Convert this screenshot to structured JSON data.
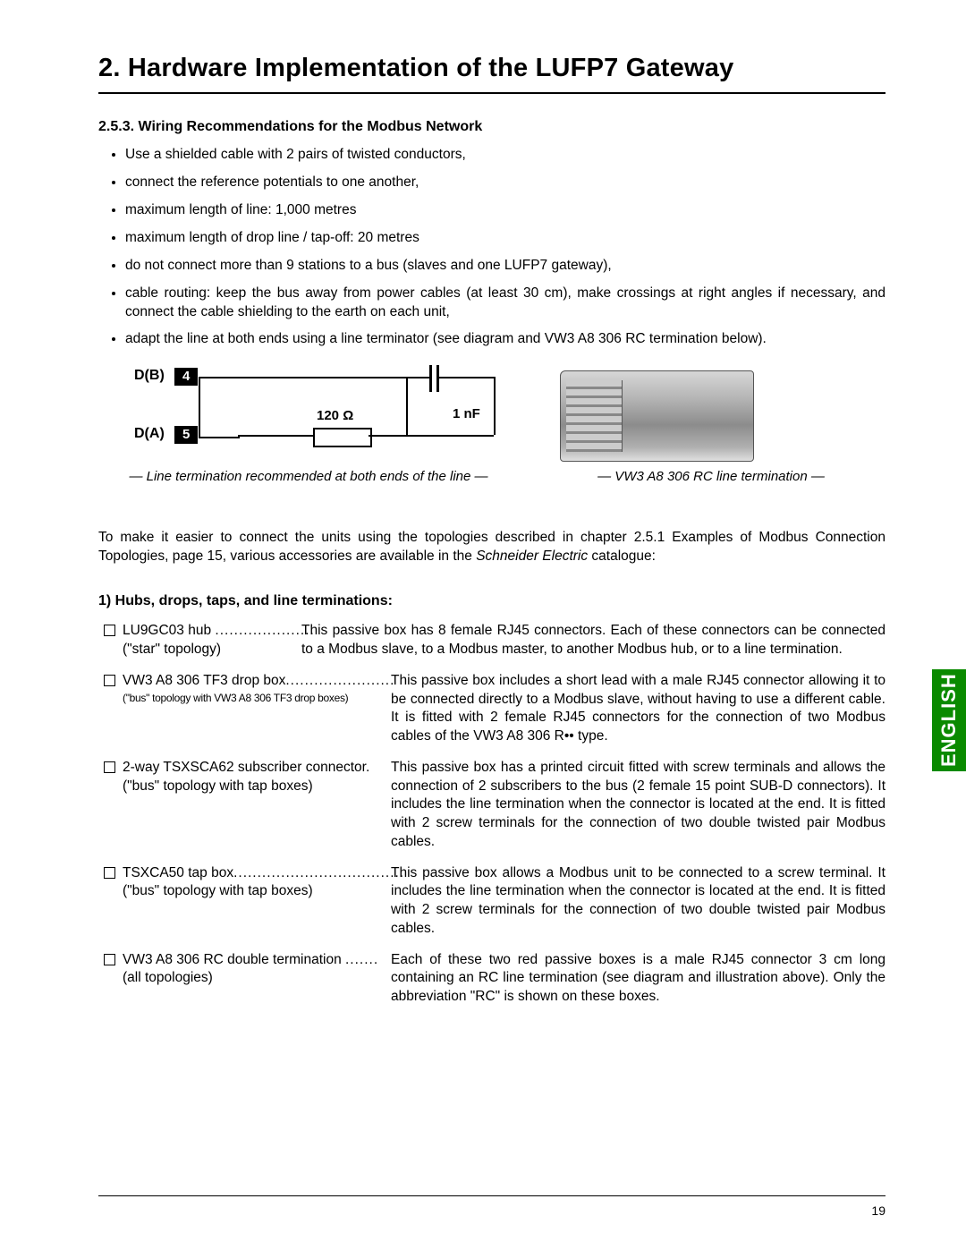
{
  "page_number": "19",
  "language_tab": "ENGLISH",
  "chapter_title": "2. Hardware Implementation of the LUFP7 Gateway",
  "section": {
    "number": "2.5.3.",
    "title": "Wiring Recommendations for the Modbus Network"
  },
  "bullets": [
    "Use a shielded cable with 2 pairs of twisted conductors,",
    "connect the reference potentials to one another,",
    "maximum length of line: 1,000 metres",
    "maximum length of drop line / tap-off: 20 metres",
    "do not connect more than 9 stations to a bus (slaves and one LUFP7 gateway),",
    "cable routing: keep the bus away from power cables (at least 30 cm), make crossings at right angles if necessary, and connect the cable shielding to the earth on each unit,",
    "adapt the line at both ends using a line terminator (see diagram and VW3 A8 306 RC termination below)."
  ],
  "diagram": {
    "db": "D(B)",
    "da": "D(A)",
    "pin4": "4",
    "pin5": "5",
    "r": "120 Ω",
    "c": "1 nF"
  },
  "caption_left": "— Line termination recommended at both ends of the line —",
  "caption_right": "— VW3 A8 306 RC line termination —",
  "intro_para": "To make it easier to connect the units using the topologies described in chapter 2.5.1 Examples of Modbus Connection Topologies, page 15, various accessories are available in the ",
  "intro_italic": "Schneider Electric",
  "intro_tail": " catalogue:",
  "subhead": "1) Hubs, drops, taps, and line terminations:",
  "items": [
    {
      "title": "LU9GC03 hub ",
      "dots": ".....................",
      "sub": "(\"star\" topology)",
      "sub_class": "",
      "left_width": "200",
      "desc": "This passive box has 8 female RJ45 connectors. Each of these connectors can be connected to a Modbus slave, to a Modbus master, to another Modbus hub, or to a line termination."
    },
    {
      "title": "VW3 A8 306 TF3 drop box",
      "dots": ".......................",
      "sub": "(\"bus\" topology with VW3 A8 306 TF3 drop boxes)",
      "sub_class": "small2",
      "left_width": "300",
      "desc": "This passive box includes a short lead with a male RJ45 connector allowing it to be connected directly to a Modbus slave, without having to use a different cable. It is fitted with 2 female RJ45 connectors for the connection of two Modbus cables of the VW3 A8 306 R•• type."
    },
    {
      "title": "2-way TSXSCA62 subscriber connector.",
      "dots": "",
      "sub": "(\"bus\" topology with tap boxes)",
      "sub_class": "",
      "left_width": "300",
      "desc": "This passive box has a printed circuit fitted with screw terminals and allows the connection of 2 subscribers to the bus (2 female 15 point SUB-D connectors). It includes the line termination when the connector is located at the end. It is fitted with 2 screw terminals for the connection of two double twisted pair Modbus cables."
    },
    {
      "title": "TSXCA50 tap box",
      "dots": "....................................",
      "sub": "(\"bus\" topology with tap boxes)",
      "sub_class": "",
      "left_width": "300",
      "desc": "This passive box allows a Modbus unit to be connected to a screw terminal. It includes the line termination when the connector is located at the end. It is fitted with 2 screw terminals for the connection of two double twisted pair Modbus cables."
    },
    {
      "title": "VW3 A8 306 RC double termination ",
      "dots": ".......",
      "sub": "(all topologies)",
      "sub_class": "",
      "left_width": "300",
      "desc": "Each of these two red passive boxes is a male RJ45 connector 3 cm long containing an RC line termination (see diagram and illustration above). Only the abbreviation \"RC\" is shown on these boxes."
    }
  ]
}
